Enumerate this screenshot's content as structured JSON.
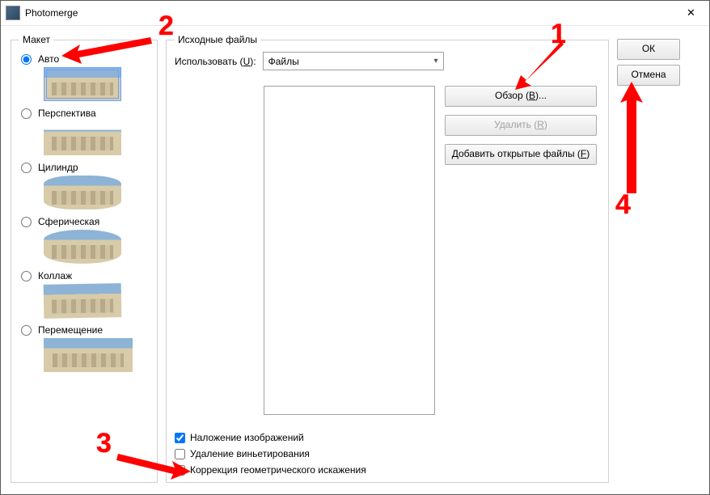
{
  "window": {
    "title": "Photomerge",
    "close_icon": "✕"
  },
  "layout": {
    "legend": "Макет",
    "options": {
      "auto": "Авто",
      "perspective": "Перспектива",
      "cylindrical": "Цилиндр",
      "spherical": "Сферическая",
      "collage": "Коллаж",
      "reposition": "Перемещение"
    },
    "selected": "auto"
  },
  "source": {
    "legend": "Исходные файлы",
    "use_label": "Использовать (",
    "use_hotkey": "U",
    "use_label_after": "):",
    "use_value": "Файлы",
    "browse": "Обзор (",
    "browse_hotkey": "B",
    "browse_after": ")...",
    "remove": "Удалить (",
    "remove_hotkey": "R",
    "remove_after": ")",
    "add_open": "Добавить открытые файлы (",
    "add_open_hotkey": "F",
    "add_open_after": ")"
  },
  "checks": {
    "blend": "Наложение изображений",
    "vignette": "Удаление виньетирования",
    "geometric": "Коррекция геометрического искажения"
  },
  "actions": {
    "ok": "ОК",
    "cancel": "Отмена"
  },
  "annotations": {
    "n1": "1",
    "n2": "2",
    "n3": "3",
    "n4": "4"
  }
}
